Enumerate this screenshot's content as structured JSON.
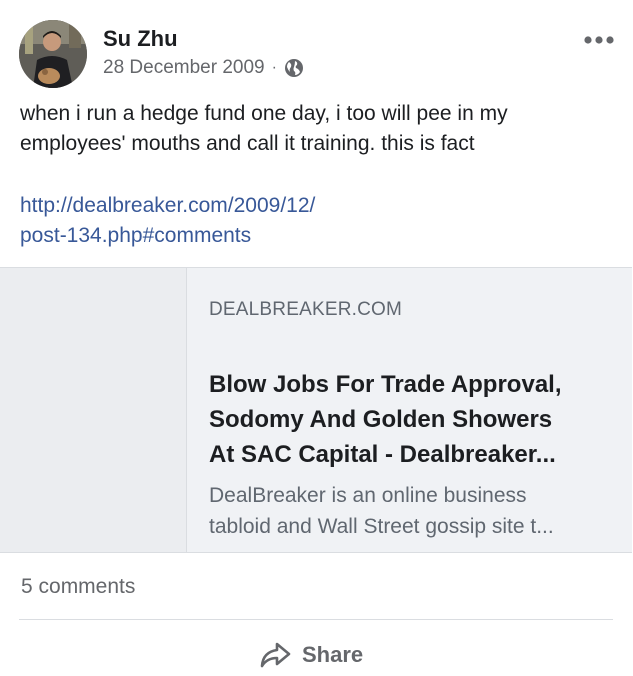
{
  "post": {
    "author": "Su Zhu",
    "date": "28 December 2009",
    "separator": "·",
    "privacy_icon": "globe-icon",
    "more_icon": "more-options-icon",
    "text_lines": [
      "when i run a hedge fund one day, i too will pee in my",
      "employees' mouths and call it training. this is fact"
    ],
    "link_lines": [
      "http://dealbreaker.com/2009/12/",
      "post-134.php#comments"
    ]
  },
  "preview": {
    "domain": "DEALBREAKER.COM",
    "title_lines": [
      "Blow Jobs For Trade Approval,",
      "Sodomy And Golden Showers",
      "At SAC Capital - Dealbreaker..."
    ],
    "desc_lines": [
      "DealBreaker is an online business",
      "tabloid and Wall Street gossip site t..."
    ]
  },
  "footer": {
    "comments": "5 comments",
    "share_label": "Share",
    "share_icon": "share-arrow-icon"
  },
  "colors": {
    "text": "#1c1e21",
    "secondary": "#65676b",
    "link": "#385898",
    "preview_bg": "#f0f2f5",
    "divider": "#dadde1"
  }
}
